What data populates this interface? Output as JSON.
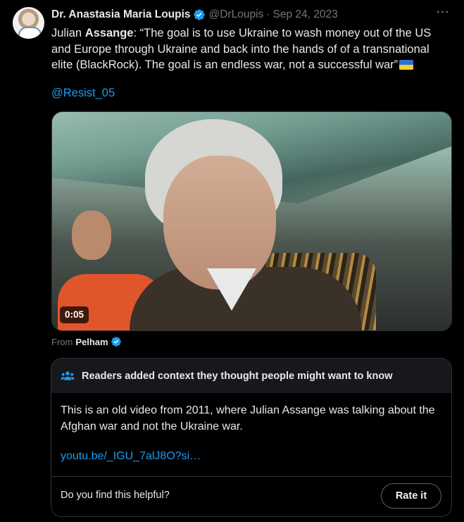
{
  "tweet": {
    "author_name": "Dr. Anastasia Maria Loupis",
    "author_handle": "@DrLoupis",
    "separator": "·",
    "date": "Sep 24, 2023",
    "more_label": "···",
    "text_prefix": "Julian ",
    "text_bold": "Assange",
    "text_body": ": “The goal is to use Ukraine to wash money out of the US and Europe through Ukraine and back into the hands of of a transnational elite (BlackRock). The goal is an endless war, not a successful war”",
    "flag_icon": "ukraine-flag-icon",
    "mention": "@Resist_05"
  },
  "video": {
    "duration": "0:05"
  },
  "attribution": {
    "from_label": "From",
    "source_name": "Pelham"
  },
  "community_note": {
    "header": "Readers added context they thought people might want to know",
    "body": "This is an old video from 2011, where Julian Assange was talking about the Afghan war and not the Ukraine war.",
    "link": "youtu.be/_IGU_7alJ8O?si…",
    "helpful_question": "Do you find this helpful?",
    "rate_label": "Rate it"
  },
  "colors": {
    "background": "#000000",
    "link": "#1d9bf0",
    "verified": "#1d9bf0",
    "muted": "#71767b",
    "note_header_bg": "#16181c"
  }
}
